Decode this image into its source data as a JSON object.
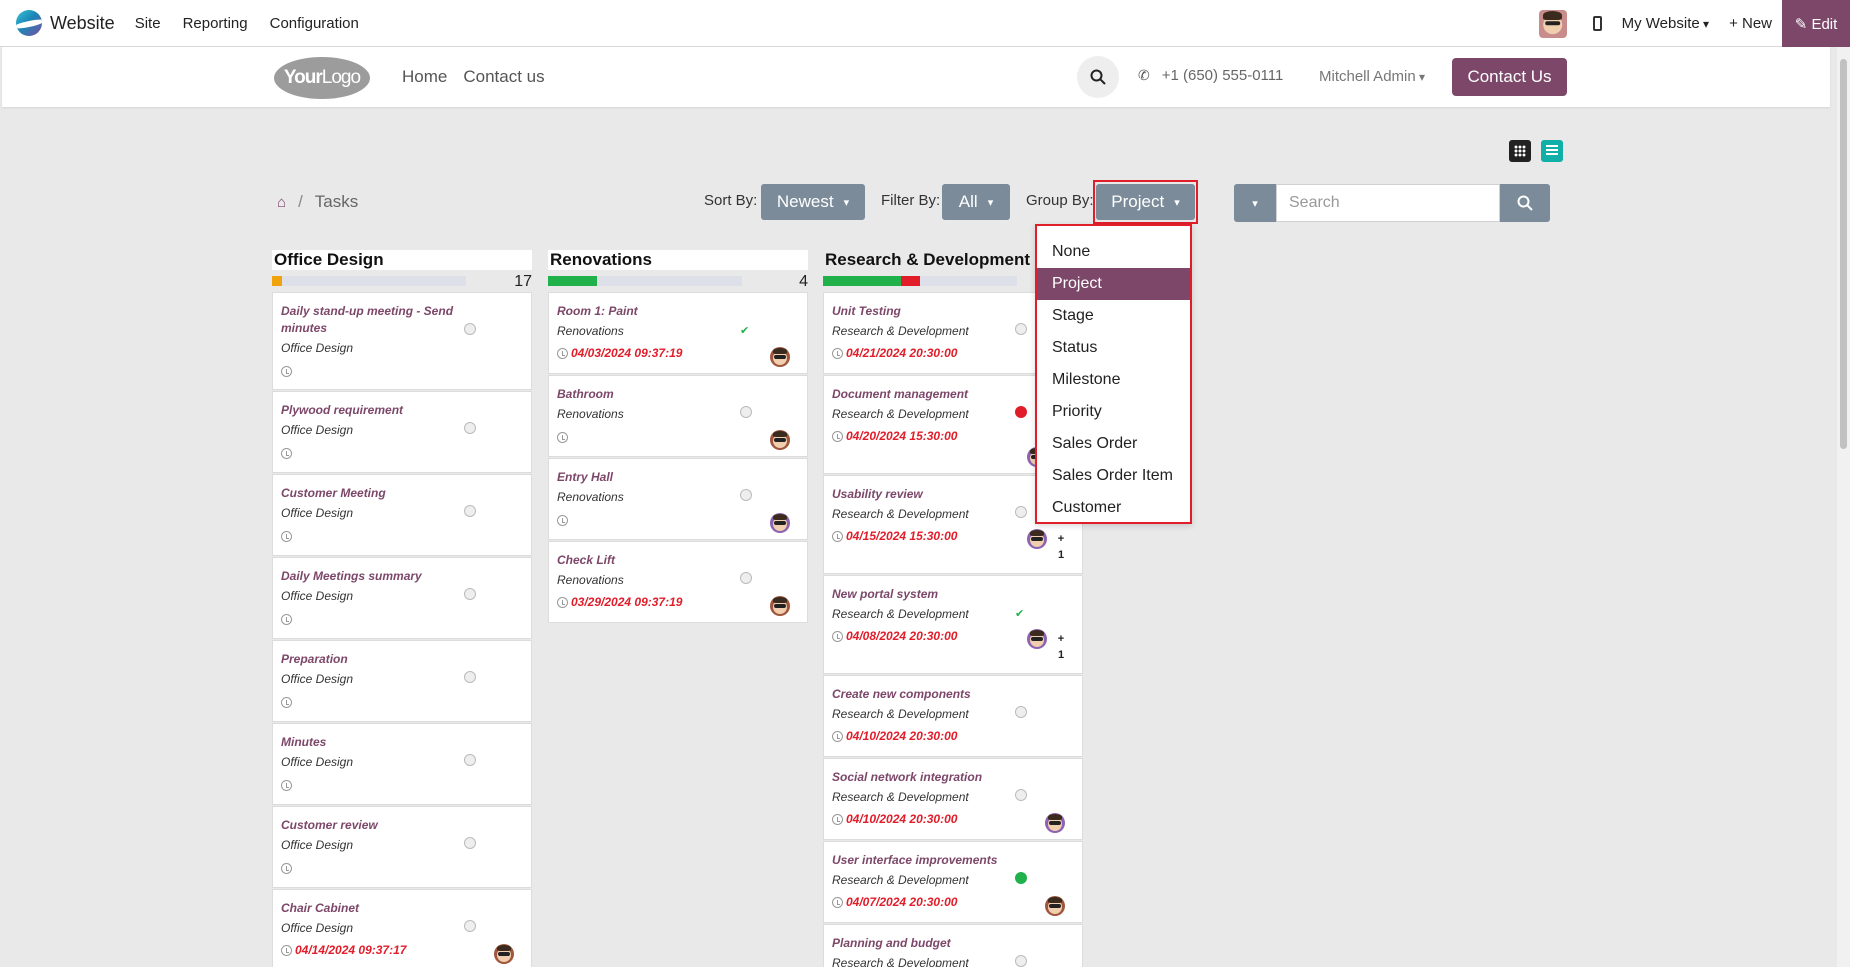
{
  "topbar": {
    "app_name": "Website",
    "menu": [
      "Site",
      "Reporting",
      "Configuration"
    ],
    "my_website": "My Website",
    "new_label": "+ New",
    "edit_label": "✎ Edit"
  },
  "site_header": {
    "logo_bold": "Your",
    "logo_light": "Logo",
    "nav": [
      "Home",
      "Contact us"
    ],
    "phone": "+1 (650) 555-0111",
    "user": "Mitchell Admin",
    "contact_button": "Contact Us"
  },
  "breadcrumb": {
    "separator": "/",
    "current": "Tasks"
  },
  "controls": {
    "sort_label": "Sort By:",
    "sort_value": "Newest",
    "filter_label": "Filter By:",
    "filter_value": "All",
    "group_label": "Group By:",
    "group_value": "Project",
    "search_placeholder": "Search"
  },
  "group_menu": {
    "items": [
      "None",
      "Project",
      "Stage",
      "Status",
      "Milestone",
      "Priority",
      "Sales Order",
      "Sales Order Item",
      "Customer"
    ],
    "selected": "Project"
  },
  "colors": {
    "accent": "#7c4769",
    "danger": "#e11d2a",
    "success": "#21b14b",
    "button_gray": "#7b8b99"
  },
  "columns": [
    {
      "title": "Office Design",
      "count": "17",
      "progress": [
        {
          "color": "#f0a30a",
          "fraction": 0.05
        }
      ],
      "cards": [
        {
          "title": "Daily stand-up meeting - Send minutes",
          "project": "Office Design",
          "date": "",
          "status": "normal",
          "avatar": ""
        },
        {
          "title": "Plywood requirement",
          "project": "Office Design",
          "date": "",
          "status": "normal",
          "avatar": ""
        },
        {
          "title": "Customer Meeting",
          "project": "Office Design",
          "date": "",
          "status": "normal",
          "avatar": ""
        },
        {
          "title": "Daily Meetings summary",
          "project": "Office Design",
          "date": "",
          "status": "normal",
          "avatar": ""
        },
        {
          "title": "Preparation",
          "project": "Office Design",
          "date": "",
          "status": "normal",
          "avatar": ""
        },
        {
          "title": "Minutes",
          "project": "Office Design",
          "date": "",
          "status": "normal",
          "avatar": ""
        },
        {
          "title": "Customer review",
          "project": "Office Design",
          "date": "",
          "status": "normal",
          "avatar": ""
        },
        {
          "title": "Chair Cabinet",
          "project": "Office Design",
          "date": "04/14/2024 09:37:17",
          "status": "normal",
          "avatar": "brown"
        }
      ]
    },
    {
      "title": "Renovations",
      "count": "4",
      "progress": [
        {
          "color": "#21b14b",
          "fraction": 0.25
        }
      ],
      "cards": [
        {
          "title": "Room 1: Paint",
          "project": "Renovations",
          "date": "04/03/2024 09:37:19",
          "status": "check",
          "avatar": "brown"
        },
        {
          "title": "Bathroom",
          "project": "Renovations",
          "date": "",
          "status": "normal",
          "avatar": "brown"
        },
        {
          "title": "Entry Hall",
          "project": "Renovations",
          "date": "",
          "status": "normal",
          "avatar": "purple"
        },
        {
          "title": "Check Lift",
          "project": "Renovations",
          "date": "03/29/2024 09:37:19",
          "status": "normal",
          "avatar": "brown"
        }
      ]
    },
    {
      "title": "Research & Development",
      "count": "",
      "progress": [
        {
          "color": "#21b14b",
          "fraction": 0.4
        },
        {
          "color": "#e11d2a",
          "fraction": 0.1
        }
      ],
      "cards": [
        {
          "title": "Unit Testing",
          "project": "Research & Development",
          "date": "04/21/2024 20:30:00",
          "status": "normal",
          "avatar": ""
        },
        {
          "title": "Document management",
          "project": "Research & Development",
          "date": "04/20/2024 15:30:00",
          "status": "block",
          "avatar": "purple"
        },
        {
          "title": "Usability review",
          "project": "Research & Development",
          "date": "04/15/2024 15:30:00",
          "status": "normal",
          "avatar": "purple",
          "extra": "+ 1"
        },
        {
          "title": "New portal system",
          "project": "Research & Development",
          "date": "04/08/2024 20:30:00",
          "status": "check",
          "avatar": "purple",
          "extra": "+ 1"
        },
        {
          "title": "Create new components",
          "project": "Research & Development",
          "date": "04/10/2024 20:30:00",
          "status": "normal",
          "avatar": ""
        },
        {
          "title": "Social network integration",
          "project": "Research & Development",
          "date": "04/10/2024 20:30:00",
          "status": "normal",
          "avatar": "purple"
        },
        {
          "title": "User interface improvements",
          "project": "Research & Development",
          "date": "04/07/2024 20:30:00",
          "status": "green",
          "avatar": "brown"
        },
        {
          "title": "Planning and budget",
          "project": "Research & Development",
          "date": "",
          "status": "normal",
          "avatar": ""
        }
      ]
    }
  ]
}
